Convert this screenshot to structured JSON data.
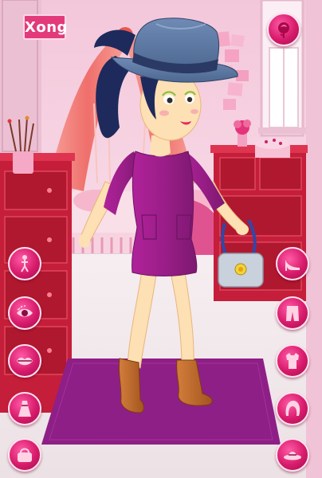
{
  "game": {
    "done_label": "Xong"
  },
  "left_menu": [
    {
      "name": "body-category",
      "icon": "body-figure-icon"
    },
    {
      "name": "eyes-category",
      "icon": "eye-icon"
    },
    {
      "name": "lips-category",
      "icon": "lips-icon"
    },
    {
      "name": "dress-category",
      "icon": "dress-icon"
    },
    {
      "name": "bag-category",
      "icon": "handbag-icon"
    }
  ],
  "right_menu": [
    {
      "name": "shoes-category",
      "icon": "high-heel-icon"
    },
    {
      "name": "pants-category",
      "icon": "pants-icon"
    },
    {
      "name": "top-category",
      "icon": "top-icon"
    },
    {
      "name": "hair-category",
      "icon": "hair-icon"
    },
    {
      "name": "hat-category",
      "icon": "hat-icon"
    }
  ],
  "top_right": {
    "name": "background-button",
    "icon": "rose-icon"
  },
  "colors": {
    "accent": "#e23a7a",
    "button": "#d81b6b",
    "wall": "#f4c9dc",
    "furniture": "#c8213a",
    "rug": "#8e1f86",
    "dress": "#9c1f86"
  }
}
